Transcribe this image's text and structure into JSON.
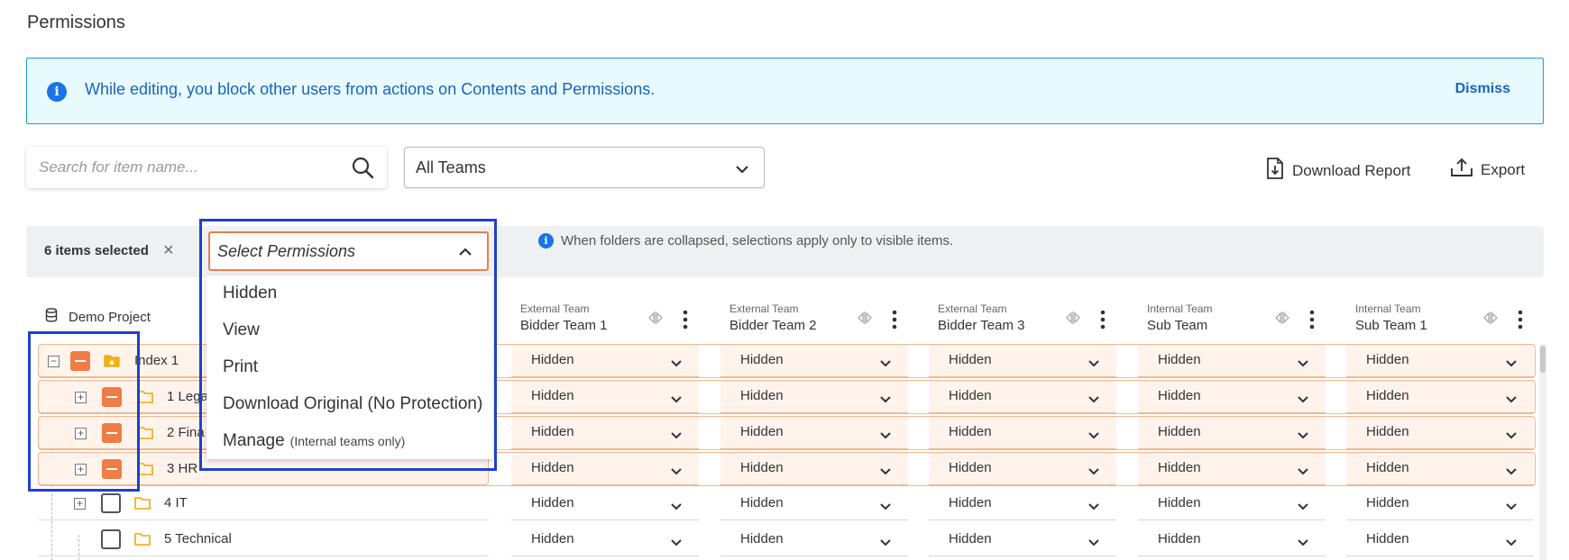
{
  "page_title": "Permissions",
  "alert": {
    "message": "While editing, you block other users from actions on Contents and Permissions.",
    "dismiss_label": "Dismiss",
    "info_glyph": "i"
  },
  "search": {
    "placeholder": "Search for item name..."
  },
  "teams_filter": {
    "selected": "All Teams"
  },
  "toolbar": {
    "download_report_label": "Download Report",
    "export_label": "Export"
  },
  "selection_bar": {
    "count_label": "6 items selected",
    "clear_glyph": "×",
    "note": "When folders are collapsed, selections apply only to visible items.",
    "info_glyph": "i"
  },
  "permission_select": {
    "placeholder": "Select Permissions",
    "options": [
      {
        "label": "Hidden",
        "note": ""
      },
      {
        "label": "View",
        "note": ""
      },
      {
        "label": "Print",
        "note": ""
      },
      {
        "label": "Download Original (No Protection)",
        "note": ""
      },
      {
        "label": "Manage",
        "note": "(Internal teams only)"
      }
    ]
  },
  "tree": {
    "project_name": "Demo Project",
    "rows": [
      {
        "label": "Index 1",
        "selected": true,
        "expander": "−"
      },
      {
        "label": "1 Lega",
        "selected": true,
        "expander": "+"
      },
      {
        "label": "2 Fina",
        "selected": true,
        "expander": "+"
      },
      {
        "label": "3 HR",
        "selected": true,
        "expander": "+"
      },
      {
        "label": "4 IT",
        "selected": false,
        "expander": "+"
      },
      {
        "label": "5 Technical",
        "selected": false,
        "expander": ""
      }
    ]
  },
  "columns": [
    {
      "type": "External Team",
      "name": "Bidder Team 1"
    },
    {
      "type": "External Team",
      "name": "Bidder Team 2"
    },
    {
      "type": "External Team",
      "name": "Bidder Team 3"
    },
    {
      "type": "Internal Team",
      "name": "Sub Team"
    },
    {
      "type": "Internal Team",
      "name": "Sub Team 1"
    }
  ],
  "cells": [
    [
      "Hidden",
      "Hidden",
      "Hidden",
      "Hidden",
      "Hidden"
    ],
    [
      "Hidden",
      "Hidden",
      "Hidden",
      "Hidden",
      "Hidden"
    ],
    [
      "Hidden",
      "Hidden",
      "Hidden",
      "Hidden",
      "Hidden"
    ],
    [
      "Hidden",
      "Hidden",
      "Hidden",
      "Hidden",
      "Hidden"
    ],
    [
      "Hidden",
      "Hidden",
      "Hidden",
      "Hidden",
      "Hidden"
    ],
    [
      "Hidden",
      "Hidden",
      "Hidden",
      "Hidden",
      "Hidden"
    ]
  ],
  "colors": {
    "accent_orange": "#ef7d45",
    "selected_row_bg": "#fff3ec",
    "alert_bg": "#e8fafd",
    "alert_text": "#1565c0",
    "highlight_blue": "#1f3fcf",
    "folder_yellow": "#f2a900"
  },
  "icons": {
    "search": "search-icon",
    "chevron": "chevron-down-icon",
    "chevron_up": "chevron-up-icon",
    "download_report": "file-download-icon",
    "export": "upload-icon",
    "database": "database-icon",
    "folder": "folder-icon",
    "home_folder": "folder-home-icon",
    "kebab": "kebab-menu-icon",
    "resize": "column-resize-icon"
  }
}
